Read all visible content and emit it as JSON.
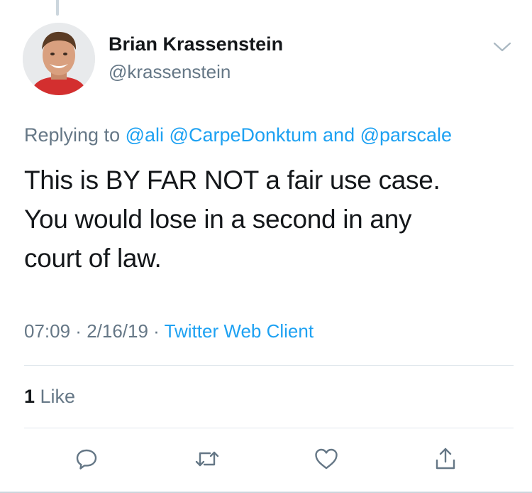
{
  "tweet": {
    "author_name": "Brian Krassenstein",
    "author_handle": "@krassenstein",
    "replying_prefix": "Replying to ",
    "mention_1": "@ali",
    "mention_2": "@CarpeDonktum",
    "mention_joiner": " and ",
    "mention_3": "@parscale",
    "text_line_1": "This is BY FAR NOT a fair use case.",
    "text_line_2": "You would lose in a second in any",
    "text_line_3": "court of law.",
    "time": "07:09",
    "separator": " · ",
    "date": "2/16/19",
    "client": "Twitter Web Client",
    "like_count": "1",
    "like_label": " Like"
  },
  "actions": {
    "reply": "reply-icon",
    "retweet": "retweet-icon",
    "like": "heart-icon",
    "share": "share-icon",
    "more": "chevron-down-icon"
  },
  "colors": {
    "text": "#14171a",
    "secondary": "#657786",
    "link": "#1da1f2",
    "divider": "#e1e8ed"
  }
}
